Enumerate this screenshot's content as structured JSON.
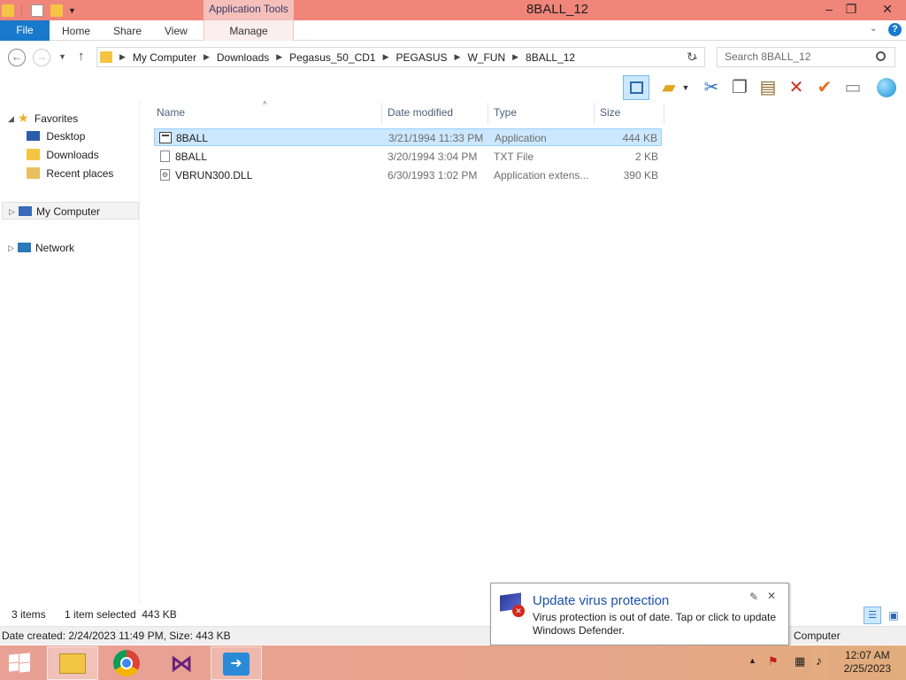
{
  "window": {
    "title": "8BALL_12",
    "contextual_tab_group": "Application Tools",
    "minimize": "–",
    "restore": "❐",
    "close": "✕"
  },
  "ribbon": {
    "tabs": [
      "File",
      "Home",
      "Share",
      "View",
      "Manage"
    ]
  },
  "address": {
    "path": [
      "My Computer",
      "Downloads",
      "Pegasus_50_CD1",
      "PEGASUS",
      "W_FUN",
      "8BALL_12"
    ],
    "search_placeholder": "Search 8BALL_12"
  },
  "toolbar": {
    "icons": [
      "preview-pane-icon",
      "folder-options-icon",
      "cut-icon",
      "copy-icon",
      "paste-icon",
      "delete-icon",
      "checkmark-icon",
      "rename-icon",
      "globe-icon"
    ]
  },
  "nav_pane": {
    "favorites": "Favorites",
    "favorites_items": [
      "Desktop",
      "Downloads",
      "Recent places"
    ],
    "my_computer": "My Computer",
    "network": "Network"
  },
  "columns": {
    "name": "Name",
    "date_modified": "Date modified",
    "type": "Type",
    "size": "Size"
  },
  "files": [
    {
      "name": "8BALL",
      "date": "3/21/1994 11:33 PM",
      "type": "Application",
      "size": "444 KB",
      "icon": "application-icon",
      "selected": true
    },
    {
      "name": "8BALL",
      "date": "3/20/1994 3:04 PM",
      "type": "TXT File",
      "size": "2 KB",
      "icon": "text-file-icon",
      "selected": false
    },
    {
      "name": "VBRUN300.DLL",
      "date": "6/30/1993 1:02 PM",
      "type": "Application extens...",
      "size": "390 KB",
      "icon": "dll-file-icon",
      "selected": false
    }
  ],
  "status": {
    "items": "3 items",
    "selected": "1 item selected  443 KB",
    "details": "Date created: 2/24/2023 11:49 PM, Size: 443 KB",
    "computer": "Computer"
  },
  "notification": {
    "title": "Update virus protection",
    "body": "Virus protection is out of date. Tap or click to update Windows Defender."
  },
  "taskbar": {
    "apps": [
      "file-explorer-icon",
      "chrome-icon",
      "visual-studio-icon",
      "remote-desktop-icon"
    ],
    "time": "12:07 AM",
    "date": "2/25/2023"
  }
}
